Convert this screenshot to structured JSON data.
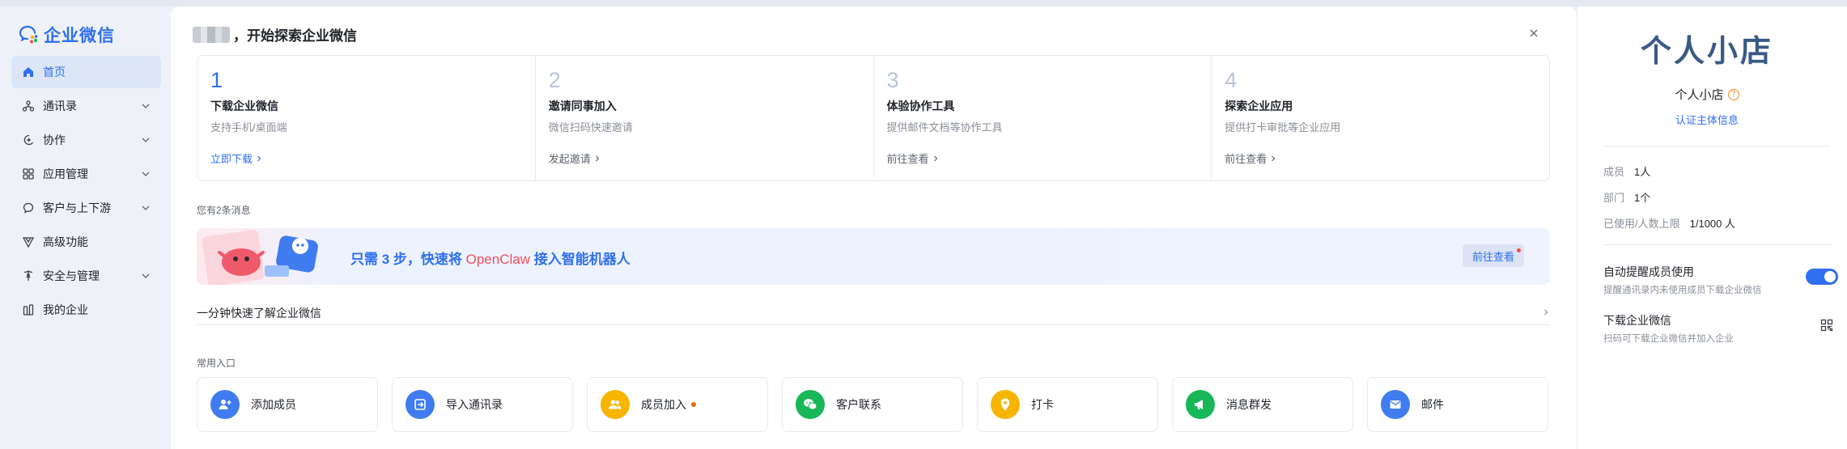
{
  "brand": {
    "name": "企业微信",
    "accent": "#2f6ff0"
  },
  "sidebar": {
    "items": [
      {
        "label": "首页",
        "icon": "home-icon",
        "active": true,
        "expandable": false
      },
      {
        "label": "通讯录",
        "icon": "contacts-icon",
        "expandable": true
      },
      {
        "label": "协作",
        "icon": "collaboration-icon",
        "expandable": true
      },
      {
        "label": "应用管理",
        "icon": "apps-grid-icon",
        "expandable": true
      },
      {
        "label": "客户与上下游",
        "icon": "chat-bubble-icon",
        "expandable": true
      },
      {
        "label": "高级功能",
        "icon": "premium-icon",
        "expandable": false
      },
      {
        "label": "安全与管理",
        "icon": "shield-icon",
        "expandable": true
      },
      {
        "label": "我的企业",
        "icon": "enterprise-icon",
        "expandable": false
      }
    ]
  },
  "main": {
    "title": "，开始探索企业微信",
    "steps": [
      {
        "num": "1",
        "title": "下载企业微信",
        "sub": "支持手机/桌面端",
        "link": "立即下载"
      },
      {
        "num": "2",
        "title": "邀请同事加入",
        "sub": "微信扫码快速邀请",
        "link": "发起邀请"
      },
      {
        "num": "3",
        "title": "体验协作工具",
        "sub": "提供邮件文档等协作工具",
        "link": "前往查看"
      },
      {
        "num": "4",
        "title": "探索企业应用",
        "sub": "提供打卡审批等企业应用",
        "link": "前往查看"
      }
    ],
    "messages_label": "您有2条消息",
    "banner": {
      "pre": "只需 3 步，快速将 ",
      "highlight": "OpenClaw",
      "post": " 接入智能机器人",
      "button": "前往查看"
    },
    "learn": "一分钟快速了解企业微信",
    "common_label": "常用入口",
    "entries": [
      {
        "label": "添加成员",
        "icon": "add-member-icon",
        "color": "blue"
      },
      {
        "label": "导入通讯录",
        "icon": "import-contacts-icon",
        "color": "blue"
      },
      {
        "label": "成员加入",
        "icon": "member-join-icon",
        "color": "yellow",
        "badge": true
      },
      {
        "label": "客户联系",
        "icon": "wechat-customer-icon",
        "color": "green"
      },
      {
        "label": "打卡",
        "icon": "check-in-icon",
        "color": "yellow"
      },
      {
        "label": "消息群发",
        "icon": "broadcast-icon",
        "color": "green"
      },
      {
        "label": "邮件",
        "icon": "mail-icon",
        "color": "blue"
      }
    ]
  },
  "right": {
    "logo_text": "个人小店",
    "org_name": "个人小店",
    "verify_link": "认证主体信息",
    "stats": [
      {
        "key": "成员",
        "value": "1人"
      },
      {
        "key": "部门",
        "value": "1个"
      },
      {
        "key": "已使用/人数上限",
        "value": "1/1000 人"
      }
    ],
    "remind": {
      "title": "自动提醒成员使用",
      "desc": "提醒通讯录内未使用成员下载企业微信",
      "enabled": true
    },
    "download": {
      "title": "下载企业微信",
      "desc": "扫码可下载企业微信并加入企业"
    }
  }
}
